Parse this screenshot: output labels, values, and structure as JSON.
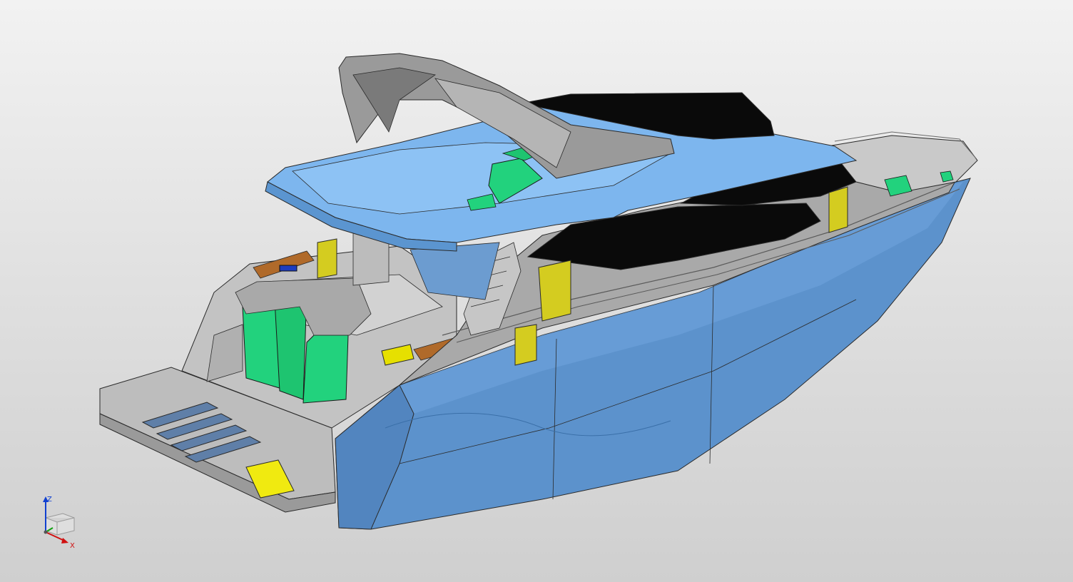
{
  "app": {
    "title": ""
  },
  "viewport": {
    "view": "isometric",
    "display_mode": "shaded-with-edges",
    "background": [
      "#f2f2f2",
      "#cfcfcf"
    ]
  },
  "model": {
    "subject": "motor-yacht-flybridge",
    "colors": {
      "hull": "#5c92cc",
      "hull_light": "#7fb3ea",
      "superstructure": "#a9a9a9",
      "deck": "#bdbdbd",
      "hardtop": "#7db6ee",
      "windows": "#0a0a0a",
      "cushions": "#22d27d",
      "hatches": "#e6e000",
      "teak": "#b06a2a",
      "edges": "#2a2a2a"
    }
  },
  "triad": {
    "z_label": "Z",
    "x_label": "X",
    "y_label": "",
    "colors": {
      "x": "#d01010",
      "y": "#10a010",
      "z": "#1040d0"
    }
  }
}
